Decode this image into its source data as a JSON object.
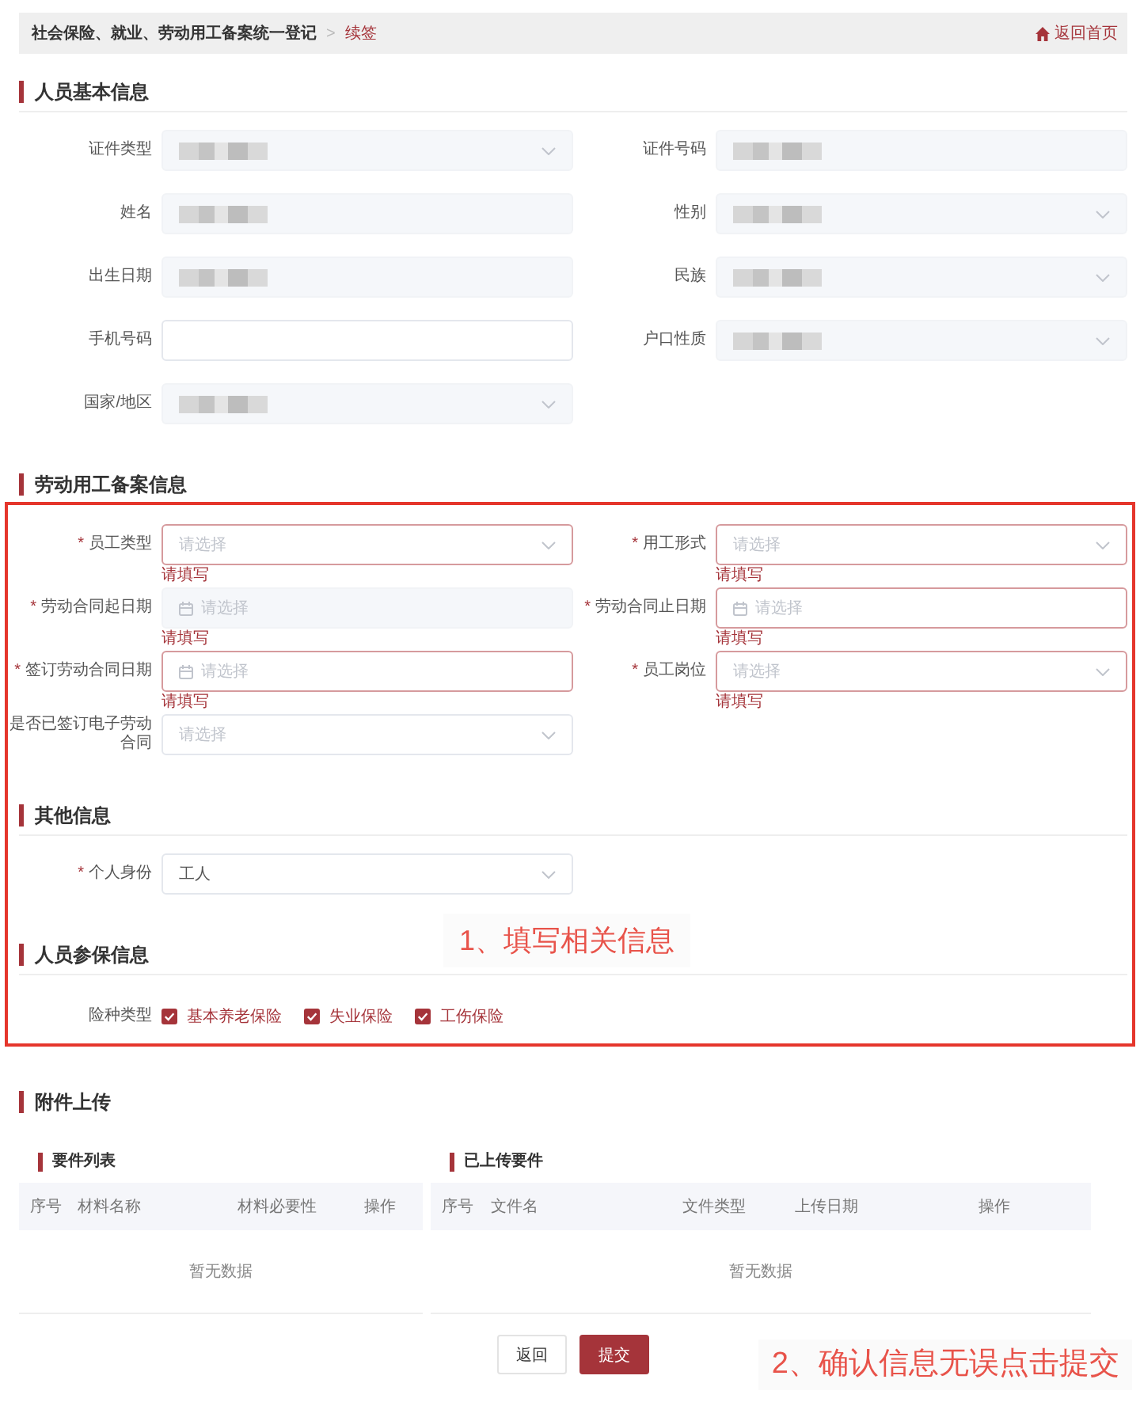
{
  "breadcrumb": {
    "items": [
      {
        "label": "社会保险、就业、劳动用工备案统一登记",
        "selected": false
      },
      {
        "label": "续签",
        "selected": true
      }
    ],
    "separator": ">",
    "home_link": "返回首页"
  },
  "sections": [
    {
      "title": "人员基本信息",
      "fields": [
        {
          "label": "证件类型",
          "kind": "select",
          "disabled": true,
          "redacted": true
        },
        {
          "label": "证件号码",
          "kind": "input",
          "disabled": true,
          "redacted": true
        },
        {
          "label": "姓名",
          "kind": "input",
          "disabled": true,
          "redacted": true
        },
        {
          "label": "性别",
          "kind": "select",
          "disabled": true,
          "redacted": true
        },
        {
          "label": "出生日期",
          "kind": "input",
          "disabled": true,
          "redacted": true
        },
        {
          "label": "民族",
          "kind": "select",
          "disabled": true,
          "redacted": true
        },
        {
          "label": "手机号码",
          "kind": "input",
          "disabled": false
        },
        {
          "label": "户口性质",
          "kind": "select",
          "disabled": true,
          "redacted": true
        },
        {
          "label": "国家/地区",
          "kind": "select",
          "disabled": true,
          "redacted": true
        }
      ]
    },
    {
      "title": "劳动用工备案信息"
    }
  ],
  "highlight": {
    "annotation": "1、填写相关信息",
    "fields": [
      {
        "required_mark": "*",
        "label": "员工类型",
        "kind": "select",
        "disabled": false,
        "placeholder": "请选择",
        "error": "请填写"
      },
      {
        "required_mark": "*",
        "label": "用工形式",
        "kind": "select",
        "disabled": false,
        "placeholder": "请选择",
        "error": "请填写"
      },
      {
        "required_mark": "*",
        "label": "劳动合同起日期",
        "kind": "date",
        "disabled": true,
        "placeholder": "请选择",
        "error": "请填写"
      },
      {
        "required_mark": "*",
        "label": "劳动合同止日期",
        "kind": "date",
        "disabled": false,
        "placeholder": "请选择",
        "error": "请填写"
      },
      {
        "required_mark": "*",
        "label": "签订劳动合同日期",
        "kind": "date",
        "disabled": false,
        "placeholder": "请选择",
        "error": "请填写"
      },
      {
        "required_mark": "*",
        "label": "员工岗位",
        "kind": "select",
        "disabled": false,
        "placeholder": "请选择",
        "error": "请填写"
      },
      {
        "label": "是否已签订电子劳动合同",
        "kind": "select",
        "disabled": false,
        "placeholder": "请选择"
      }
    ],
    "sections": [
      {
        "title": "其他信息",
        "fields": [
          {
            "required_mark": "*",
            "label": "个人身份",
            "kind": "select",
            "disabled": false,
            "value": "工人"
          }
        ]
      },
      {
        "title": "人员参保信息",
        "checkbox_groups": [
          {
            "label": "险种类型",
            "options": [
              {
                "label": "基本养老保险",
                "checked": true
              },
              {
                "label": "失业保险",
                "checked": true
              },
              {
                "label": "工伤保险",
                "checked": true
              }
            ]
          }
        ]
      }
    ]
  },
  "attachments": {
    "title": "附件上传",
    "tables": [
      {
        "title": "要件列表",
        "columns": [
          "序号",
          "材料名称",
          "材料必要性",
          "操作"
        ],
        "empty_text": "暂无数据"
      },
      {
        "title": "已上传要件",
        "columns": [
          "序号",
          "文件名",
          "文件类型",
          "上传日期",
          "操作"
        ],
        "empty_text": "暂无数据"
      }
    ]
  },
  "buttons": [
    {
      "label": "返回",
      "kind": "default"
    },
    {
      "label": "提交",
      "kind": "primary"
    }
  ],
  "footer_annotation": "2、确认信息无误点击提交"
}
